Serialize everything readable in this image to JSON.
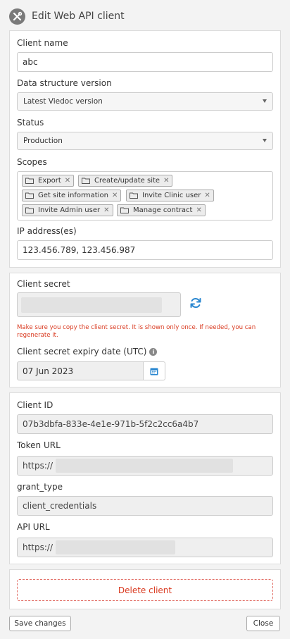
{
  "header": {
    "title": "Edit Web API client",
    "icon": "tools-icon"
  },
  "client": {
    "name_label": "Client name",
    "name_value": "abc",
    "dsv_label": "Data structure version",
    "dsv_value": "Latest Viedoc version",
    "status_label": "Status",
    "status_value": "Production",
    "scopes_label": "Scopes",
    "scopes": [
      "Export",
      "Create/update site",
      "Get site information",
      "Invite Clinic user",
      "Invite Admin user",
      "Manage contract"
    ],
    "ip_label": "IP address(es)",
    "ip_value": "123.456.789, 123.456.987"
  },
  "secret": {
    "label": "Client secret",
    "warning": "Make sure you copy the client secret. It is shown only once. If needed, you can regenerate it.",
    "expiry_label": "Client secret expiry date (UTC)",
    "expiry_value": "07 Jun 2023"
  },
  "details": {
    "client_id_label": "Client ID",
    "client_id_value": "07b3dbfa-833e-4e1e-971b-5f2c2cc6a4b7",
    "token_url_label": "Token URL",
    "token_url_prefix": "https://",
    "grant_type_label": "grant_type",
    "grant_type_value": "client_credentials",
    "api_url_label": "API URL",
    "api_url_prefix": "https://"
  },
  "actions": {
    "delete_label": "Delete client",
    "save_label": "Save changes",
    "close_label": "Close"
  },
  "colors": {
    "warning": "#d9391f",
    "accent": "#2a87d0"
  }
}
